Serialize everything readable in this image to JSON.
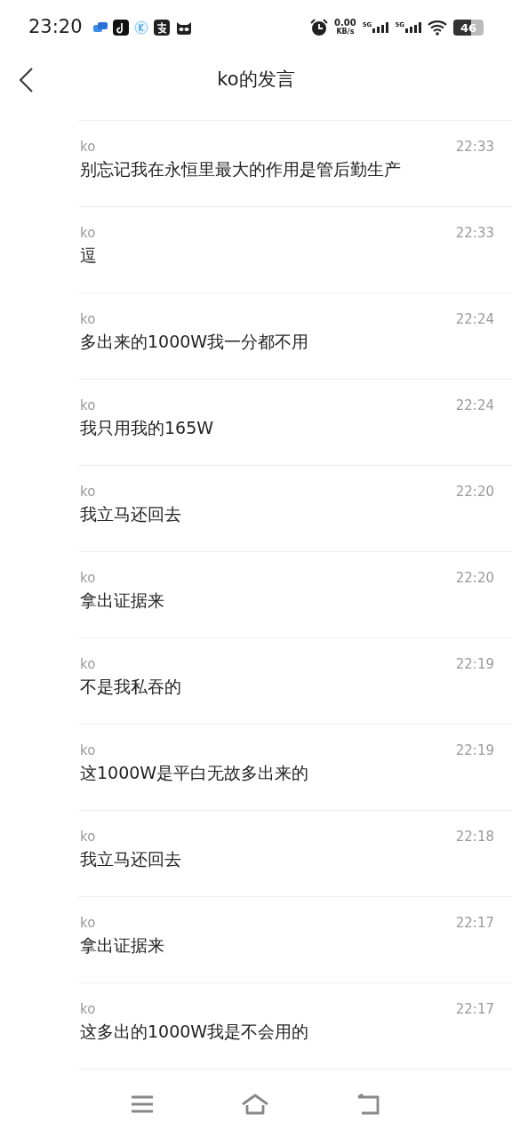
{
  "status_bar": {
    "time": "23:20",
    "net_speed": "0.00",
    "net_unit": "KB/s",
    "sim1": "5G",
    "sim2": "5G",
    "battery": "46"
  },
  "header": {
    "title": "ko的发言"
  },
  "messages": [
    {
      "name": "ko",
      "time": "22:33",
      "text": "别忘记我在永恒里最大的作用是管后勤生产"
    },
    {
      "name": "ko",
      "time": "22:33",
      "text": "逗"
    },
    {
      "name": "ko",
      "time": "22:24",
      "text": "多出来的1000W我一分都不用"
    },
    {
      "name": "ko",
      "time": "22:24",
      "text": "我只用我的165W"
    },
    {
      "name": "ko",
      "time": "22:20",
      "text": "我立马还回去"
    },
    {
      "name": "ko",
      "time": "22:20",
      "text": "拿出证据来"
    },
    {
      "name": "ko",
      "time": "22:19",
      "text": "不是我私吞的"
    },
    {
      "name": "ko",
      "time": "22:19",
      "text": "这1000W是平白无故多出来的"
    },
    {
      "name": "ko",
      "time": "22:18",
      "text": "我立马还回去"
    },
    {
      "name": "ko",
      "time": "22:17",
      "text": "拿出证据来"
    },
    {
      "name": "ko",
      "time": "22:17",
      "text": "这多出的1000W我是不会用的"
    }
  ]
}
